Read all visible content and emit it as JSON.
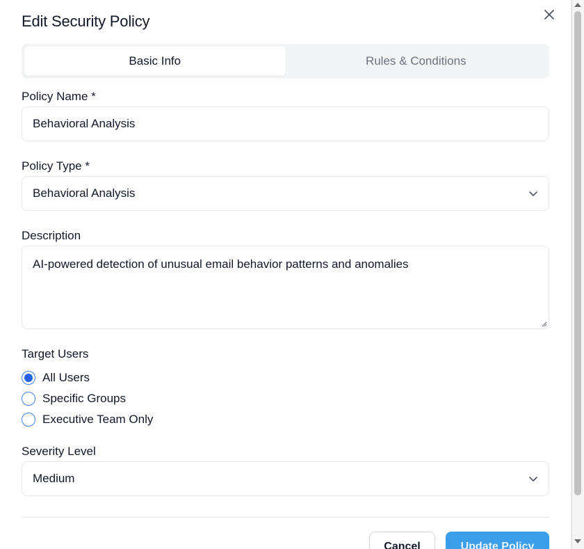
{
  "dialog": {
    "title": "Edit Security Policy"
  },
  "tabs": [
    {
      "label": "Basic Info",
      "active": true
    },
    {
      "label": "Rules & Conditions",
      "active": false
    }
  ],
  "form": {
    "policy_name": {
      "label": "Policy Name *",
      "value": "Behavioral Analysis"
    },
    "policy_type": {
      "label": "Policy Type *",
      "value": "Behavioral Analysis"
    },
    "description": {
      "label": "Description",
      "value": "AI-powered detection of unusual email behavior patterns and anomalies"
    },
    "target_users": {
      "label": "Target Users",
      "options": [
        {
          "label": "All Users",
          "checked": true
        },
        {
          "label": "Specific Groups",
          "checked": false
        },
        {
          "label": "Executive Team Only",
          "checked": false
        }
      ]
    },
    "severity": {
      "label": "Severity Level",
      "value": "Medium"
    }
  },
  "footer": {
    "cancel_label": "Cancel",
    "submit_label": "Update Policy"
  },
  "colors": {
    "accent": "#2563eb",
    "primary_button": "#3b9eea"
  },
  "icons": {
    "close": "close-icon",
    "chevron": "chevron-down-icon"
  }
}
